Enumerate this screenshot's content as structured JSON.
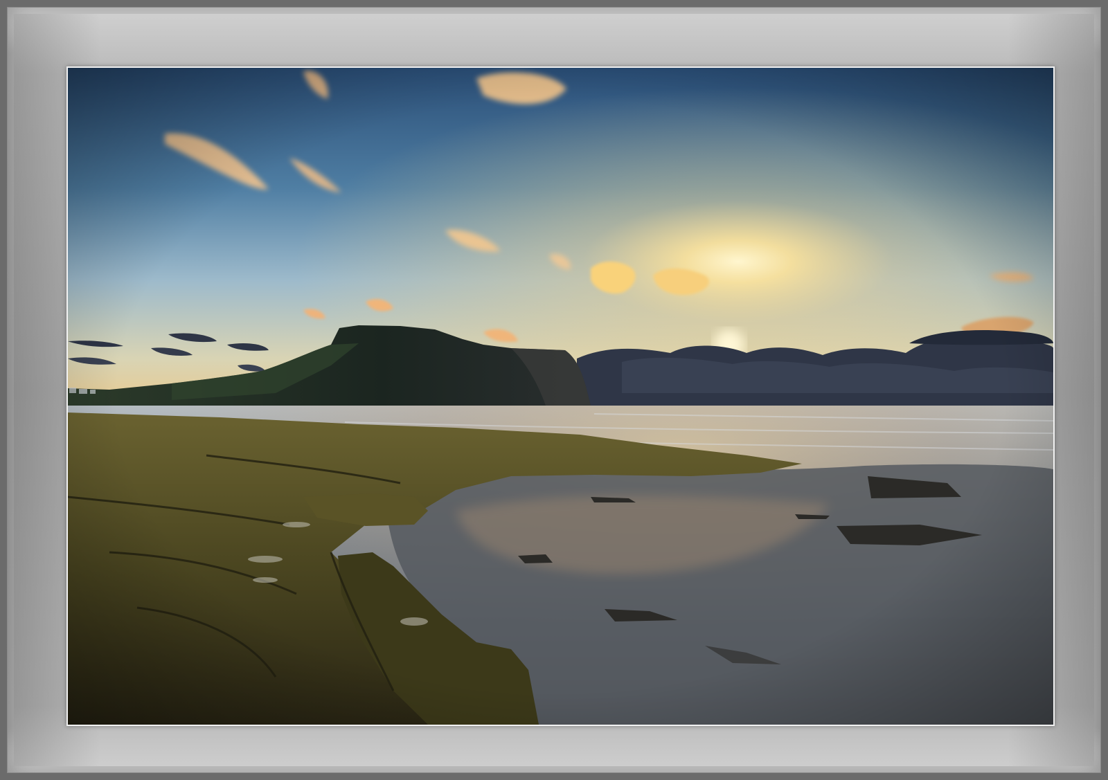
{
  "image": {
    "subject": "",
    "palette": {
      "sky_top": "#2f5a86",
      "sky_mid": "#7aa0b8",
      "sky_glow": "#f4e3a6",
      "sun": "#fff3c4",
      "cloud_lit": "#f5c77e",
      "cloud_dark": "#2c3447",
      "headland": "#1d2a22",
      "sea": "#8d9aa4",
      "tidepool": "#5e6166",
      "moss_rock": "#4f4a1f",
      "frame_grey": "#b3b3b3"
    }
  }
}
